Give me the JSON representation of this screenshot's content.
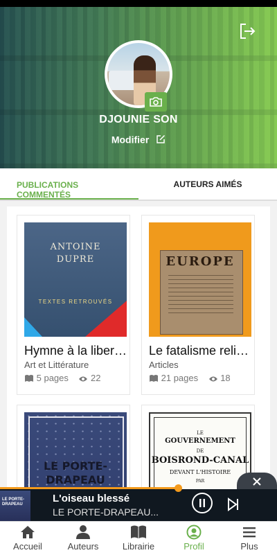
{
  "profile": {
    "name": "DJOUNIE SON",
    "modify_label": "Modifier"
  },
  "tabs": [
    {
      "label": "PUBLICATIONS COMMENTÉS",
      "active": true
    },
    {
      "label": "AUTEURS AIMÉS",
      "active": false
    }
  ],
  "books": [
    {
      "title": "Hymne à la liber…",
      "category": "Art et Littérature",
      "pages": "5 pages",
      "views": "22",
      "cover_text": [
        "ANTOINE",
        "DUPRE",
        "TEXTES RETROUVÉS"
      ]
    },
    {
      "title": "Le fatalisme reli…",
      "category": "Articles",
      "pages": "21 pages",
      "views": "18",
      "cover_text": [
        "EUROPE"
      ]
    },
    {
      "title": "",
      "category": "",
      "pages": "",
      "views": "",
      "cover_text": [
        "LE PORTE-",
        "DRAPEAU"
      ]
    },
    {
      "title": "",
      "category": "",
      "pages": "",
      "views": "",
      "cover_text": [
        "LE",
        "GOUVERNEMENT",
        "DE",
        "BOISROND-CANAL",
        "DEVANT L'HISTOIRE",
        "PAR"
      ]
    }
  ],
  "player": {
    "title": "L'oiseau blessé",
    "subtitle": "LE PORTE-DRAPEAU...",
    "thumb_text": "LE PORTE-\nDRAPEAU",
    "progress": 0.645,
    "accent": "#f39a1c"
  },
  "nav": [
    {
      "label": "Accueil",
      "icon": "home-icon"
    },
    {
      "label": "Auteurs",
      "icon": "person-icon"
    },
    {
      "label": "Librairie",
      "icon": "book-icon"
    },
    {
      "label": "Profil",
      "icon": "profile-icon",
      "active": true
    },
    {
      "label": "Plus",
      "icon": "menu-icon"
    }
  ],
  "colors": {
    "accent_green": "#6ab04c",
    "player_bg": "#101820"
  }
}
